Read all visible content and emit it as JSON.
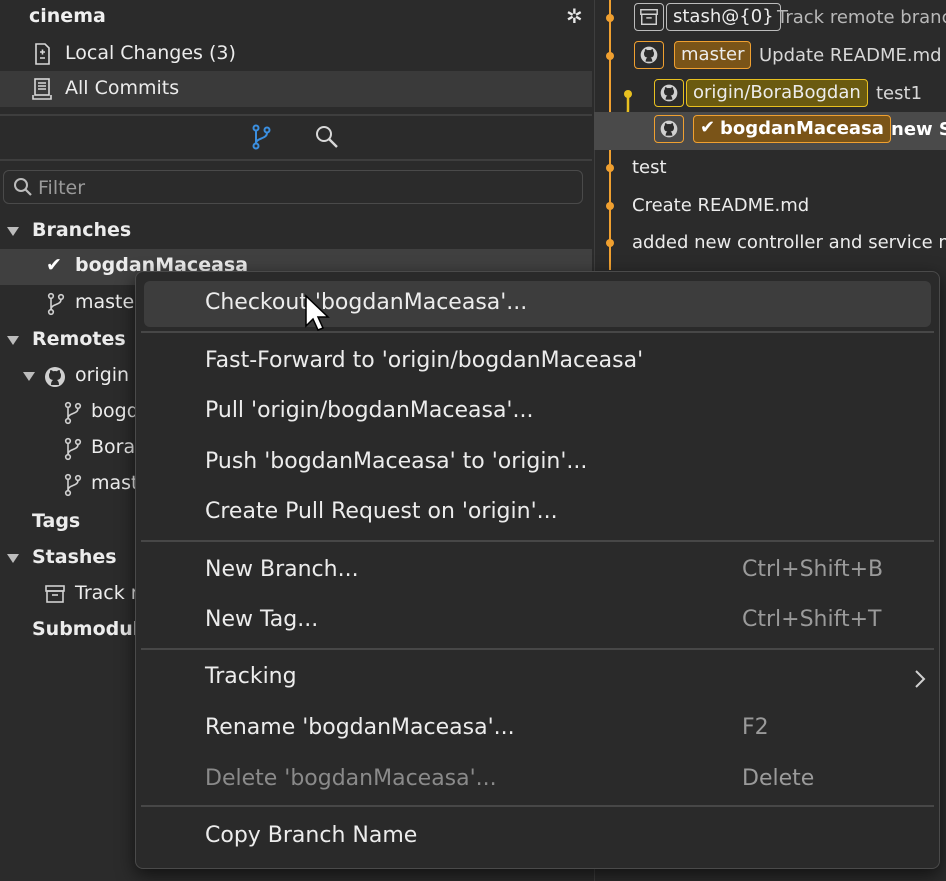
{
  "repo": {
    "name": "cinema"
  },
  "nav": {
    "local_changes": "Local Changes (3)",
    "all_commits": "All Commits"
  },
  "filter": {
    "placeholder": "Filter"
  },
  "tree": {
    "branches_header": "Branches",
    "branches": [
      "bogdanMaceasa",
      "master"
    ],
    "remotes_header": "Remotes",
    "remote_name": "origin",
    "remote_branches": [
      "bogd",
      "Bora",
      "mast"
    ],
    "tags_header": "Tags",
    "stashes_header": "Stashes",
    "stash_item": "Track r",
    "submodules_header": "Submodul"
  },
  "commits": [
    {
      "badge": "stash@{0}",
      "message": "Track remote branch"
    },
    {
      "badge": "master",
      "message": "Update README.md"
    },
    {
      "badge": "origin/BoraBogdan",
      "message": "test1"
    },
    {
      "badge": "bogdanMaceasa",
      "message": "new S"
    },
    {
      "message": "test"
    },
    {
      "message": "Create README.md"
    },
    {
      "message": "added new controller and service mo"
    }
  ],
  "menu": {
    "checkout": "Checkout 'bogdanMaceasa'...",
    "fast_forward": "Fast-Forward to 'origin/bogdanMaceasa'",
    "pull": "Pull 'origin/bogdanMaceasa'...",
    "push": "Push 'bogdanMaceasa' to 'origin'...",
    "create_pr": "Create Pull Request on 'origin'...",
    "new_branch": "New Branch...",
    "new_branch_shortcut": "Ctrl+Shift+B",
    "new_tag": "New Tag...",
    "new_tag_shortcut": "Ctrl+Shift+T",
    "tracking": "Tracking",
    "rename": "Rename 'bogdanMaceasa'...",
    "rename_shortcut": "F2",
    "delete": "Delete 'bogdanMaceasa'...",
    "delete_shortcut": "Delete",
    "copy_name": "Copy Branch Name"
  },
  "colors": {
    "accent_orange": "#f0a030",
    "accent_yellow": "#e8c020",
    "blue_icon": "#3b8fe0"
  }
}
